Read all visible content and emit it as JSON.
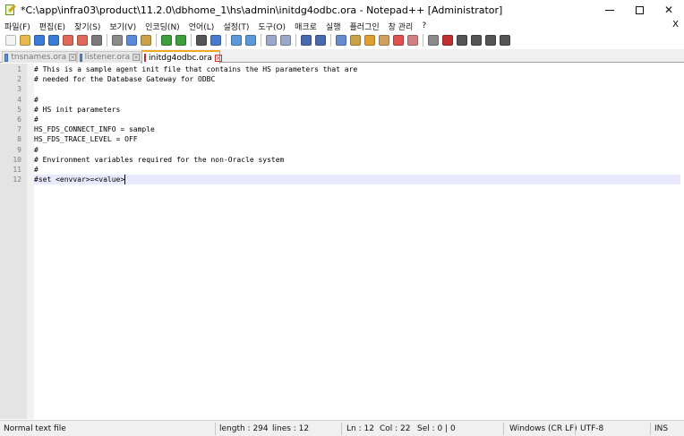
{
  "window": {
    "title": "*C:\\app\\infra03\\product\\11.2.0\\dbhome_1\\hs\\admin\\initdg4odbc.ora - Notepad++ [Administrator]"
  },
  "menu": [
    "파일(F)",
    "편집(E)",
    "찾기(S)",
    "보기(V)",
    "인코딩(N)",
    "언어(L)",
    "설정(T)",
    "도구(O)",
    "매크로",
    "실행",
    "플러그인",
    "창 관리",
    "?"
  ],
  "menu_close": "X",
  "toolbar": {
    "icons": [
      "new-file-icon",
      "open-file-icon",
      "save-icon",
      "save-all-icon",
      "close-icon",
      "close-all-icon",
      "print-icon",
      "cut-icon",
      "copy-icon",
      "paste-icon",
      "undo-icon",
      "redo-icon",
      "find-icon",
      "replace-icon",
      "zoom-in-icon",
      "zoom-out-icon",
      "sync-vertical-icon",
      "sync-horizontal-icon",
      "word-wrap-icon",
      "show-all-chars-icon",
      "indent-guide-icon",
      "language-icon",
      "function-list-icon",
      "folder-workspace-icon",
      "document-map-icon",
      "monitor-icon",
      "record-macro-icon",
      "stop-macro-icon",
      "play-macro-icon",
      "run-macro-icon",
      "save-macro-icon",
      "spell-check-icon"
    ]
  },
  "tabs": [
    {
      "label": "tnsnames.ora",
      "active": false
    },
    {
      "label": "listener.ora",
      "active": false
    },
    {
      "label": "initdg4odbc.ora",
      "active": true
    }
  ],
  "editor": {
    "lines": [
      {
        "num": "1",
        "text": "# This is a sample agent init file that contains the HS parameters that are"
      },
      {
        "num": "2",
        "text": "# needed for the Database Gateway for ODBC"
      },
      {
        "num": "3",
        "text": ""
      },
      {
        "num": "4",
        "text": "#"
      },
      {
        "num": "5",
        "text": "# HS init parameters"
      },
      {
        "num": "6",
        "text": "#"
      },
      {
        "num": "7",
        "text": "HS_FDS_CONNECT_INFO = sample"
      },
      {
        "num": "8",
        "text": "HS_FDS_TRACE_LEVEL = OFF"
      },
      {
        "num": "9",
        "text": "#"
      },
      {
        "num": "10",
        "text": "# Environment variables required for the non-Oracle system"
      },
      {
        "num": "11",
        "text": "#"
      },
      {
        "num": "12",
        "text": "#set <envvar>=<value>"
      }
    ],
    "current_line": 12
  },
  "status": {
    "file_type": "Normal text file",
    "length": "length : 294",
    "lines": "lines : 12",
    "ln": "Ln : 12",
    "col": "Col : 22",
    "sel": "Sel : 0 | 0",
    "eol": "Windows (CR LF)",
    "encoding": "UTF-8",
    "mode": "INS"
  },
  "colors": {
    "current_line_bg": "#e8e8ff",
    "gutter_bg": "#e4e4e4",
    "active_tab_accent": "#f5a623"
  }
}
